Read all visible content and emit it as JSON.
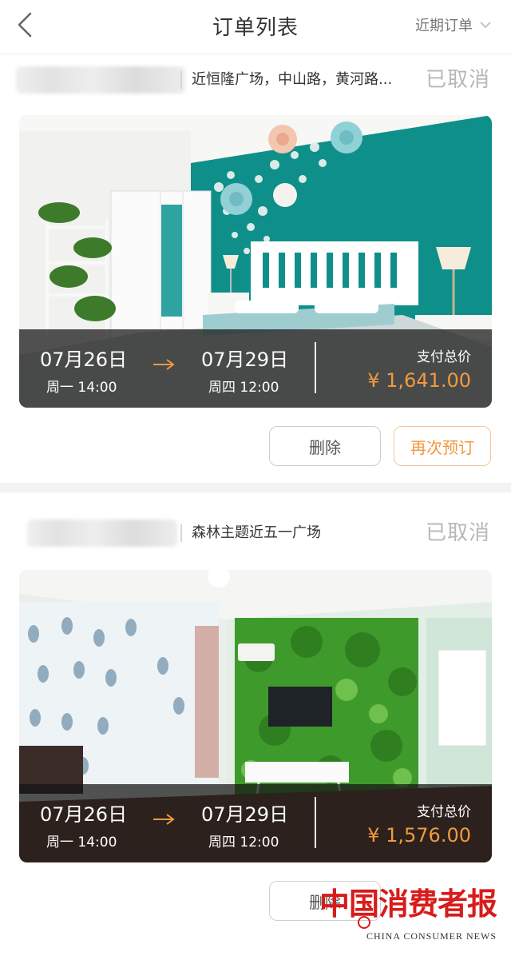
{
  "header": {
    "title": "订单列表",
    "filter_label": "近期订单"
  },
  "orders": [
    {
      "address": "近恒隆广场，中山路，黄河路...",
      "status": "已取消",
      "checkin_date": "07月26日",
      "checkin_time": "周一 14:00",
      "checkout_date": "07月29日",
      "checkout_time": "周四 12:00",
      "pay_label": "支付总价",
      "price": "¥ 1,641.00",
      "delete_label": "删除",
      "rebook_label": "再次预订"
    },
    {
      "address": "森林主题近五一广场",
      "status": "已取消",
      "checkin_date": "07月26日",
      "checkin_time": "周一 14:00",
      "checkout_date": "07月29日",
      "checkout_time": "周四 12:00",
      "pay_label": "支付总价",
      "price": "¥ 1,576.00",
      "delete_label": "删除"
    }
  ],
  "watermark": {
    "cn": "中国消费者报",
    "en": "CHINA CONSUMER NEWS"
  },
  "colors": {
    "accent": "#f0993f",
    "status_gray": "#b8b8b8",
    "teal_wall": "#0f8f8a",
    "green_wall": "#3f9a2c"
  }
}
